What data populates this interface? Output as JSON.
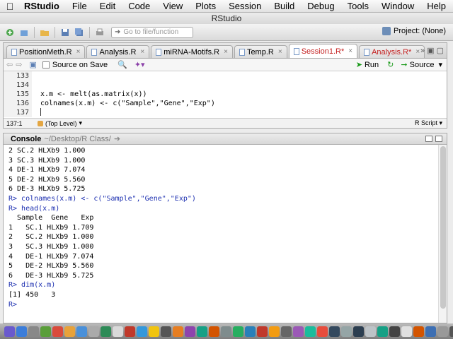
{
  "menubar": {
    "app": "RStudio",
    "items": [
      "File",
      "Edit",
      "Code",
      "View",
      "Plots",
      "Session",
      "Build",
      "Debug",
      "Tools",
      "Window",
      "Help"
    ]
  },
  "window": {
    "title": "RStudio"
  },
  "toolbar": {
    "goto_placeholder": "Go to file/function",
    "project_label": "Project: (None)"
  },
  "editor": {
    "tabs": [
      {
        "label": "PositionMeth.R",
        "modified": false
      },
      {
        "label": "Analysis.R",
        "modified": false
      },
      {
        "label": "miRNA-Motifs.R",
        "modified": false
      },
      {
        "label": "Temp.R",
        "modified": false
      },
      {
        "label": "Session1.R*",
        "modified": true
      },
      {
        "label": "Analysis.R*",
        "modified": true
      }
    ],
    "source_on_save": "Source on Save",
    "run_label": "Run",
    "source_label": "Source",
    "lines": [
      {
        "num": "133",
        "text": ""
      },
      {
        "num": "134",
        "text": ""
      },
      {
        "num": "135",
        "text": "x.m <- melt(as.matrix(x))"
      },
      {
        "num": "136",
        "text": "colnames(x.m) <- c(\"Sample\",\"Gene\",\"Exp\")"
      },
      {
        "num": "137",
        "text": ""
      }
    ],
    "status": {
      "position": "137:1",
      "level": "(Top Level)",
      "file_type": "R Script"
    }
  },
  "console": {
    "title": "Console",
    "path": "~/Desktop/R Class/",
    "lines": [
      {
        "text": "2 SC.2 HLXb9 1.000",
        "cmd": false
      },
      {
        "text": "3 SC.3 HLXb9 1.000",
        "cmd": false
      },
      {
        "text": "4 DE-1 HLXb9 7.074",
        "cmd": false
      },
      {
        "text": "5 DE-2 HLXb9 5.560",
        "cmd": false
      },
      {
        "text": "6 DE-3 HLXb9 5.725",
        "cmd": false
      },
      {
        "text": "R> colnames(x.m) <- c(\"Sample\",\"Gene\",\"Exp\")",
        "cmd": true
      },
      {
        "text": "R> head(x.m)",
        "cmd": true
      },
      {
        "text": "  Sample  Gene   Exp",
        "cmd": false
      },
      {
        "text": "1   SC.1 HLXb9 1.709",
        "cmd": false
      },
      {
        "text": "2   SC.2 HLXb9 1.000",
        "cmd": false
      },
      {
        "text": "3   SC.3 HLXb9 1.000",
        "cmd": false
      },
      {
        "text": "4   DE-1 HLXb9 7.074",
        "cmd": false
      },
      {
        "text": "5   DE-2 HLXb9 5.560",
        "cmd": false
      },
      {
        "text": "6   DE-3 HLXb9 5.725",
        "cmd": false
      },
      {
        "text": "R> dim(x.m)",
        "cmd": true
      },
      {
        "text": "[1] 450   3",
        "cmd": false
      }
    ],
    "prompt": "R>"
  },
  "dock_colors": [
    "#6a5acd",
    "#3c7dd9",
    "#888",
    "#5a9e3a",
    "#d94b3c",
    "#e8a23a",
    "#4a90d9",
    "#aaa",
    "#2e8b57",
    "#d9d9d9",
    "#c0392b",
    "#3498db",
    "#f1c40f",
    "#555",
    "#e67e22",
    "#8e44ad",
    "#16a085",
    "#d35400",
    "#7f8c8d",
    "#27ae60",
    "#2980b9",
    "#c0392b",
    "#f39c12",
    "#666",
    "#9b59b6",
    "#1abc9c",
    "#e74c3c",
    "#34495e",
    "#95a5a6",
    "#2c3e50",
    "#bdc3c7",
    "#16a085",
    "#444",
    "#e0e0e0",
    "#d35400",
    "#3d6fb3",
    "#999",
    "#555",
    "#b0b0b0"
  ]
}
